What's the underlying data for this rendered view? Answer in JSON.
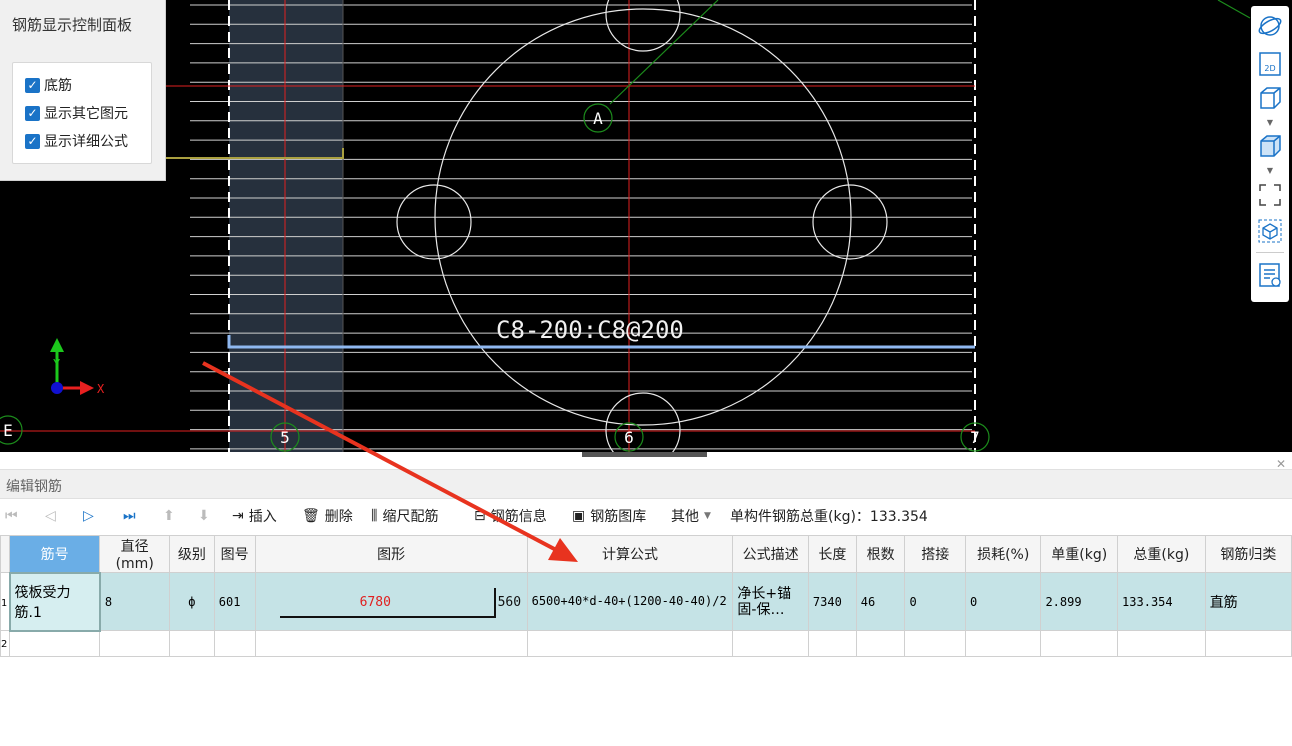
{
  "control_panel": {
    "title": "钢筋显示控制面板",
    "checkboxes": [
      {
        "label": "底筋",
        "checked": true
      },
      {
        "label": "显示其它图元",
        "checked": true
      },
      {
        "label": "显示详细公式",
        "checked": true
      }
    ]
  },
  "cad": {
    "rebar_label": "C8-200:C8@200",
    "axis_labels": {
      "a": "A",
      "e": "E",
      "five": "5",
      "six": "6",
      "seven": "7"
    },
    "coord": {
      "y": "Y",
      "x": "X"
    }
  },
  "right_toolbar": [
    "orbit-icon",
    "2d-view-icon",
    "3d-box-icon",
    "3d-box-filled-icon",
    "fullscreen-icon",
    "3d-view-cube-icon",
    "settings-view-icon"
  ],
  "editor": {
    "title": "编辑钢筋",
    "toolbar": {
      "insert": "插入",
      "delete": "删除",
      "scale_config": "缩尺配筋",
      "rebar_info": "钢筋信息",
      "rebar_library": "钢筋图库",
      "other": "其他",
      "total_weight_label": "单构件钢筋总重(kg)：133.354"
    },
    "columns": [
      "筋号",
      "直径(mm)",
      "级别",
      "图号",
      "图形",
      "计算公式",
      "公式描述",
      "长度",
      "根数",
      "搭接",
      "损耗(%)",
      "单重(kg)",
      "总重(kg)",
      "钢筋归类"
    ],
    "rows": [
      {
        "num": "筏板受力筋.1",
        "diameter": "8",
        "grade": "ф",
        "figure_no": "601",
        "shape_length": "6780",
        "shape_hook": "560",
        "formula": "6500+40*d-40+(1200-40-40)/2",
        "formula_desc": "净长+锚固-保…",
        "length": "7340",
        "count": "46",
        "lap": "0",
        "loss": "0",
        "unit_weight": "2.899",
        "total_weight": "133.354",
        "category": "直筋"
      }
    ],
    "row_numbers": [
      "1",
      "2"
    ]
  },
  "colors": {
    "accent": "#1a73c7",
    "row_highlight": "#c5e3e6",
    "header_active": "#6aaee6",
    "annotation": "#e8331f"
  }
}
